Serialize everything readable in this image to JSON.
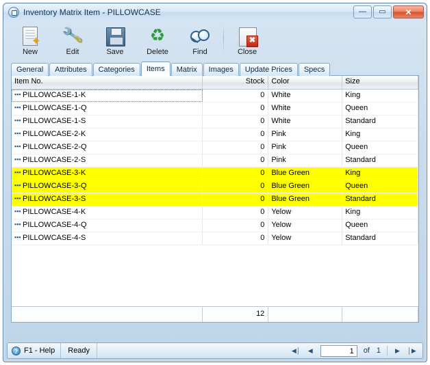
{
  "window": {
    "title": "Inventory Matrix Item - PILLOWCASE",
    "icon": "app-window-icon",
    "buttons": {
      "minimize": "—",
      "maximize": "▭",
      "close": "✕"
    }
  },
  "toolbar": {
    "items": [
      {
        "label": "New",
        "icon": "new-document-icon"
      },
      {
        "label": "Edit",
        "icon": "edit-wrench-pencil-icon"
      },
      {
        "label": "Save",
        "icon": "save-floppy-icon"
      },
      {
        "label": "Delete",
        "icon": "delete-recycle-icon"
      },
      {
        "label": "Find",
        "icon": "find-binoculars-icon"
      },
      {
        "label": "Close",
        "icon": "close-document-icon"
      }
    ]
  },
  "tabs": {
    "active": "Items",
    "items": [
      "General",
      "Attributes",
      "Categories",
      "Items",
      "Matrix",
      "Images",
      "Update Prices",
      "Specs"
    ]
  },
  "grid": {
    "columns": [
      "Item No.",
      "Stock",
      "Color",
      "Size"
    ],
    "rows": [
      {
        "item": "PILLOWCASE-1-K",
        "stock": "0",
        "color": "White",
        "size": "King",
        "highlight": false
      },
      {
        "item": "PILLOWCASE-1-Q",
        "stock": "0",
        "color": "White",
        "size": "Queen",
        "highlight": false
      },
      {
        "item": "PILLOWCASE-1-S",
        "stock": "0",
        "color": "White",
        "size": "Standard",
        "highlight": false
      },
      {
        "item": "PILLOWCASE-2-K",
        "stock": "0",
        "color": "Pink",
        "size": "King",
        "highlight": false
      },
      {
        "item": "PILLOWCASE-2-Q",
        "stock": "0",
        "color": "Pink",
        "size": "Queen",
        "highlight": false
      },
      {
        "item": "PILLOWCASE-2-S",
        "stock": "0",
        "color": "Pink",
        "size": "Standard",
        "highlight": false
      },
      {
        "item": "PILLOWCASE-3-K",
        "stock": "0",
        "color": "Blue Green",
        "size": "King",
        "highlight": true
      },
      {
        "item": "PILLOWCASE-3-Q",
        "stock": "0",
        "color": "Blue Green",
        "size": "Queen",
        "highlight": true
      },
      {
        "item": "PILLOWCASE-3-S",
        "stock": "0",
        "color": "Blue Green",
        "size": "Standard",
        "highlight": true
      },
      {
        "item": "PILLOWCASE-4-K",
        "stock": "0",
        "color": "Yelow",
        "size": "King",
        "highlight": false
      },
      {
        "item": "PILLOWCASE-4-Q",
        "stock": "0",
        "color": "Yelow",
        "size": "Queen",
        "highlight": false
      },
      {
        "item": "PILLOWCASE-4-S",
        "stock": "0",
        "color": "Yelow",
        "size": "Standard",
        "highlight": false
      }
    ],
    "footer": {
      "item_total": "",
      "stock_total": "12",
      "color_total": "",
      "size_total": ""
    },
    "highlight_color": "#ffff00"
  },
  "statusbar": {
    "help_label": "F1 - Help",
    "help_icon": "help-question-icon",
    "status": "Ready",
    "nav": {
      "first": "◀│",
      "prev": "◀",
      "page_value": "1",
      "of_label": "of",
      "page_count": "1",
      "next": "▶",
      "last": "│▶"
    }
  }
}
